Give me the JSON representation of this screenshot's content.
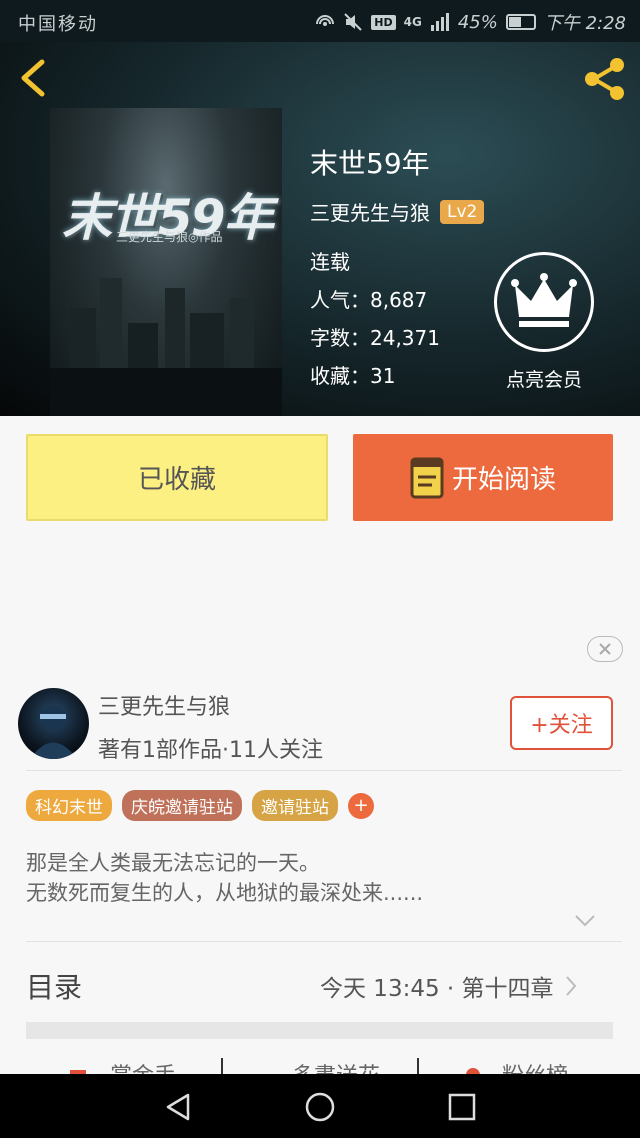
{
  "status_bar": {
    "carrier": "中国移动",
    "hd": "HD",
    "network": "4G",
    "battery_percent": "45%",
    "battery_level": 0.45,
    "time": "下午 2:28"
  },
  "book": {
    "title": "末世59年",
    "cover_title": "末世59年",
    "cover_subtitle": "三更先生与狼◎作品",
    "author": "三更先生与狼",
    "level": "Lv2",
    "status": "连载",
    "popularity": "人气：8,687",
    "word_count": "字数：24,371",
    "favorites": "收藏：31",
    "vip_label": "点亮会员"
  },
  "actions": {
    "collected_label": "已收藏",
    "read_label": "开始阅读"
  },
  "author_card": {
    "name": "三更先生与狼",
    "stats": "著有1部作品·11人关注",
    "follow_label": "+关注"
  },
  "tags": [
    {
      "label": "科幻末世",
      "color": "#eea93e"
    },
    {
      "label": "庆皖邀请驻站",
      "color": "#c0715a"
    },
    {
      "label": "邀请驻站",
      "color": "#d6a345"
    }
  ],
  "tag_add": "+",
  "description": {
    "line1": "那是全人类最无法忘记的一天。",
    "line2": "无数死而复生的人，从地狱的最深处来......"
  },
  "toc": {
    "title": "目录",
    "latest": "今天 13:45 · 第十四章"
  },
  "bottom_tabs": [
    "賞金手",
    "多書送花",
    "粉丝榜"
  ],
  "colors": {
    "accent_orange": "#ec6a3d",
    "collected_yellow": "#fdf083",
    "follow_red": "#e0533a",
    "level_badge": "#e9a94a",
    "icon_yellow": "#f2c230"
  },
  "icons": {
    "back": "chevron-left-icon",
    "share": "share-icon",
    "vip": "crown-icon",
    "book": "book-icon",
    "close": "close-icon",
    "expand": "chevron-down-icon",
    "arrow": "chevron-right-icon"
  }
}
